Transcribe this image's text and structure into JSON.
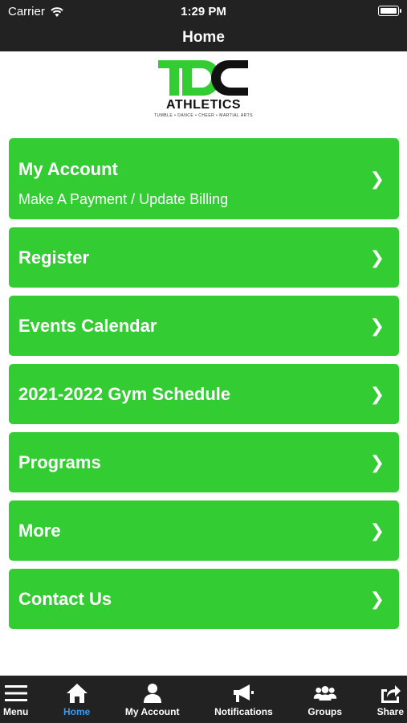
{
  "status": {
    "carrier": "Carrier",
    "time": "1:29 PM"
  },
  "header": {
    "title": "Home"
  },
  "logo": {
    "mark_text": "TDC",
    "word": "ATHLETICS",
    "tagline": "TUMBLE • DANCE • CHEER • MARTIAL ARTS",
    "brand_color": "#33cc33"
  },
  "menu": {
    "items": [
      {
        "label": "My Account",
        "sublabel": "Make A Payment / Update Billing",
        "chevron": "❯"
      },
      {
        "label": "Register",
        "chevron": "❯"
      },
      {
        "label": "Events Calendar",
        "chevron": "❯"
      },
      {
        "label": "2021-2022 Gym Schedule",
        "chevron": "❯"
      },
      {
        "label": "Programs",
        "chevron": "❯"
      },
      {
        "label": "More",
        "chevron": "❯"
      },
      {
        "label": "Contact Us",
        "chevron": "❯"
      }
    ]
  },
  "tabbar": {
    "tabs": [
      {
        "label": "Menu",
        "icon": "hamburger-icon"
      },
      {
        "label": "Home",
        "icon": "home-icon",
        "active": true
      },
      {
        "label": "My Account",
        "icon": "person-icon"
      },
      {
        "label": "Notifications",
        "icon": "megaphone-icon"
      },
      {
        "label": "Groups",
        "icon": "group-icon"
      },
      {
        "label": "Share",
        "icon": "share-icon"
      }
    ]
  },
  "colors": {
    "bar_bg": "#222222",
    "button_green": "#33cc33",
    "active_tab": "#3b9be8"
  }
}
